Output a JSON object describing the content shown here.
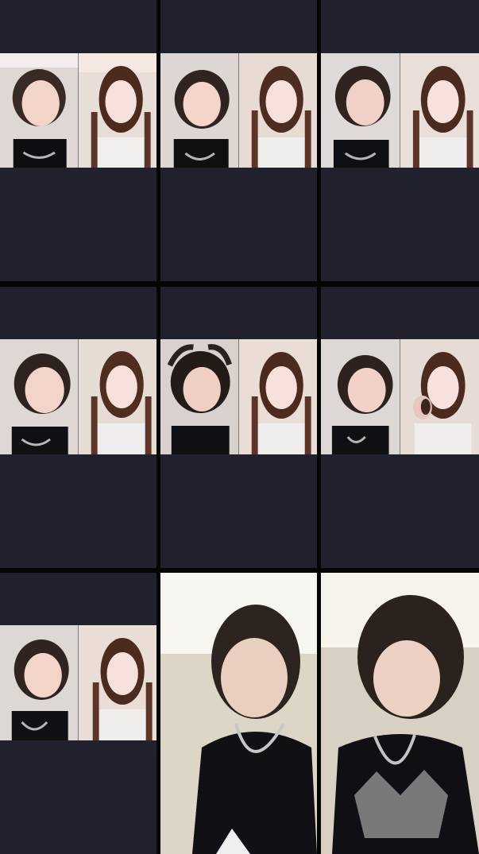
{
  "screen": {
    "panel_bg": "#20212d",
    "frame_bg": "#050505"
  },
  "tiles": [
    {
      "id": 1,
      "layout": "split"
    },
    {
      "id": 2,
      "layout": "split"
    },
    {
      "id": 3,
      "layout": "split"
    },
    {
      "id": 4,
      "layout": "split"
    },
    {
      "id": 5,
      "layout": "split"
    },
    {
      "id": 6,
      "layout": "split"
    },
    {
      "id": 7,
      "layout": "split"
    },
    {
      "id": 8,
      "layout": "full"
    },
    {
      "id": 9,
      "layout": "full"
    }
  ]
}
